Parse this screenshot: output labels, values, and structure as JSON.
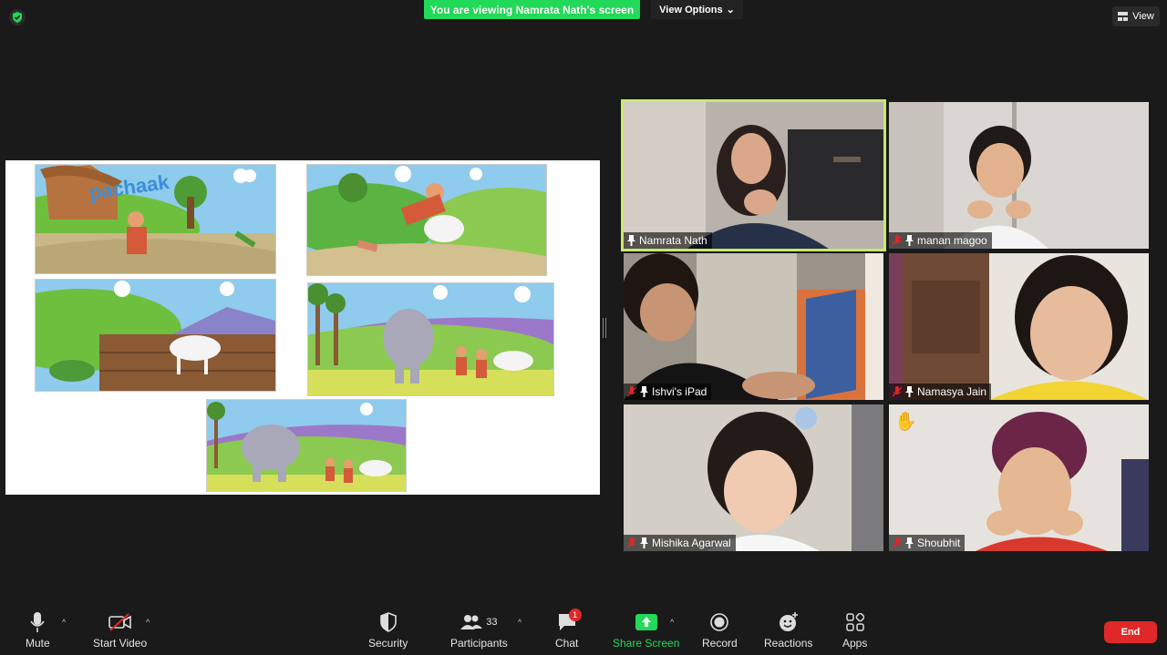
{
  "share_banner": "You are viewing Namrata Nath's screen",
  "view_options": "View Options",
  "view_button": "View",
  "participants": [
    {
      "name": "Namrata Nath",
      "muted": false,
      "active": true
    },
    {
      "name": "manan magoo",
      "muted": true,
      "active": false
    },
    {
      "name": "Ishvi's iPad",
      "muted": true,
      "active": false
    },
    {
      "name": "Namasya Jain",
      "muted": true,
      "active": false
    },
    {
      "name": "Mishika Agarwal",
      "muted": true,
      "active": false
    },
    {
      "name": "Shoubhit",
      "muted": true,
      "active": false,
      "raised_hand": true
    }
  ],
  "slide": {
    "panel_1_text": "pachaak",
    "panels": [
      "scene-village-hut",
      "scene-man-falling-cow",
      "scene-cow-running",
      "scene-elephant-villagers",
      "scene-elephant-pulling-cow"
    ]
  },
  "toolbar": {
    "mute": "Mute",
    "start_video": "Start Video",
    "security": "Security",
    "participants": "Participants",
    "participants_count": "33",
    "chat": "Chat",
    "chat_badge": "1",
    "share_screen": "Share Screen",
    "record": "Record",
    "reactions": "Reactions",
    "apps": "Apps",
    "end": "End"
  },
  "colors": {
    "share_green": "#23d959",
    "active_speaker": "#c9e86b",
    "end_red": "#e02828",
    "background": "#1a1a1a"
  }
}
